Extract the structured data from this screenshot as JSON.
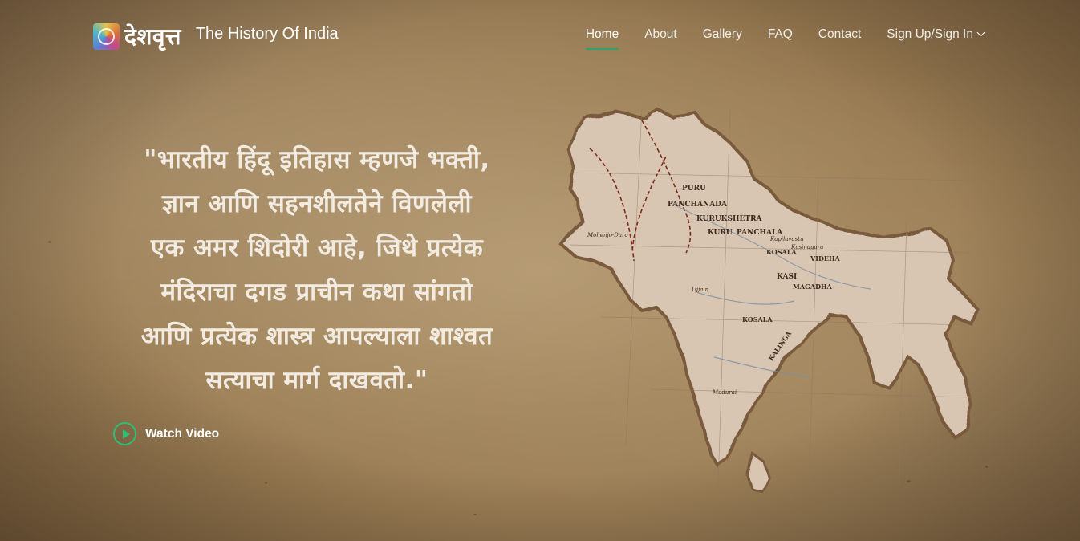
{
  "brand": {
    "name": "देशवृत्त",
    "tagline": "The History Of India"
  },
  "nav": {
    "items": [
      {
        "label": "Home"
      },
      {
        "label": "About"
      },
      {
        "label": "Gallery"
      },
      {
        "label": "FAQ"
      },
      {
        "label": "Contact"
      },
      {
        "label": "Sign Up/Sign In"
      }
    ]
  },
  "hero": {
    "quote_lines": [
      "\"भारतीय हिंदू इतिहास म्हणजे भक्ती,",
      "ज्ञान आणि सहनशीलतेने विणलेली",
      "एक अमर शिदोरी आहे, जिथे प्रत्येक",
      "मंदिराचा दगड प्राचीन कथा सांगतो",
      "आणि प्रत्येक शास्त्र आपल्याला शाश्वत",
      "सत्याचा मार्ग दाखवतो.\""
    ],
    "watch_label": "Watch Video"
  },
  "map": {
    "labels": [
      "PURU",
      "PANCHANADA",
      "KURUKSHETRA",
      "KURU",
      "PANCHALA",
      "KOSALA",
      "VIDEHA",
      "KASI",
      "MAGADHA",
      "KOSALA",
      "KALINGA",
      "Ujjain",
      "Mohenjo-Daro",
      "Kapilavastu",
      "Kusinagara",
      "Madurai"
    ]
  },
  "colors": {
    "accent": "#2fa36b",
    "play": "#2fbf74",
    "quote_text": "#f2ebe1"
  }
}
